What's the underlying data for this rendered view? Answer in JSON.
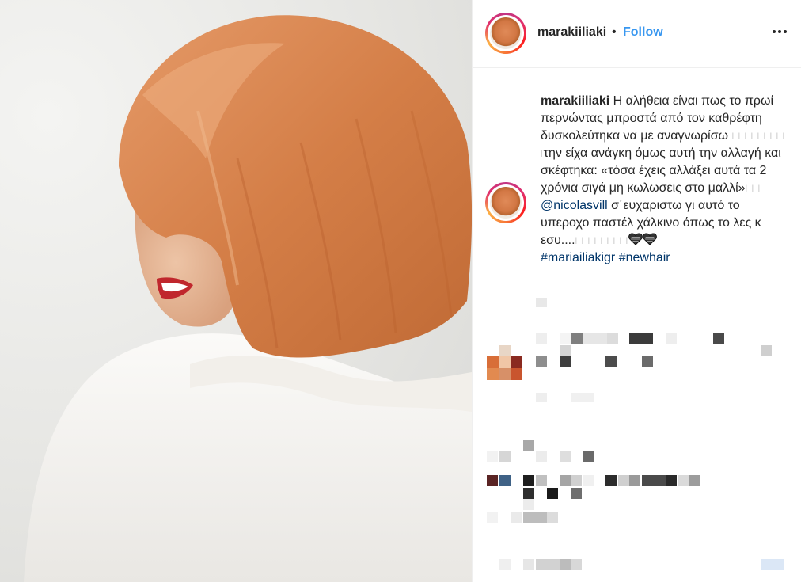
{
  "post": {
    "username": "marakiiliaki",
    "separator": "•",
    "follow_label": "Follow",
    "more_icon": "ellipsis-icon"
  },
  "caption": {
    "username": "marakiiliaki",
    "text_1": " Η αλήθεια είναι πως το πρωί περνώντας μπροστά από τον καθρέφτη δυσκολεύτηκα να με αναγνωρίσω ",
    "obscured_1": "l l l l l l l l l l",
    "text_2": "την είχα ανάγκη όμως αυτή την αλλαγή και σκέφτηκα: «τόσα έχεις αλλάξει αυτά τα 2 χρόνια σιγά μη κωλωσεις στο μαλλί»",
    "obscured_2": "l l l",
    "mention": "@nicolasvill",
    "text_3": " σ΄ευχαριστω γι αυτό το υπεροχο παστέλ χάλκινο όπως το λες κ εσυ....",
    "obscured_3": "l l l l l l l l l",
    "heart_icon_1": "black-heart-icon",
    "heart_icon_2": "black-heart-icon",
    "hashtag_1": "#mariailiakigr",
    "hashtag_2": "#newhair"
  },
  "colors": {
    "link_blue": "#3897f0",
    "tag_blue": "#003569",
    "text": "#262626",
    "hair": "#d88450"
  }
}
